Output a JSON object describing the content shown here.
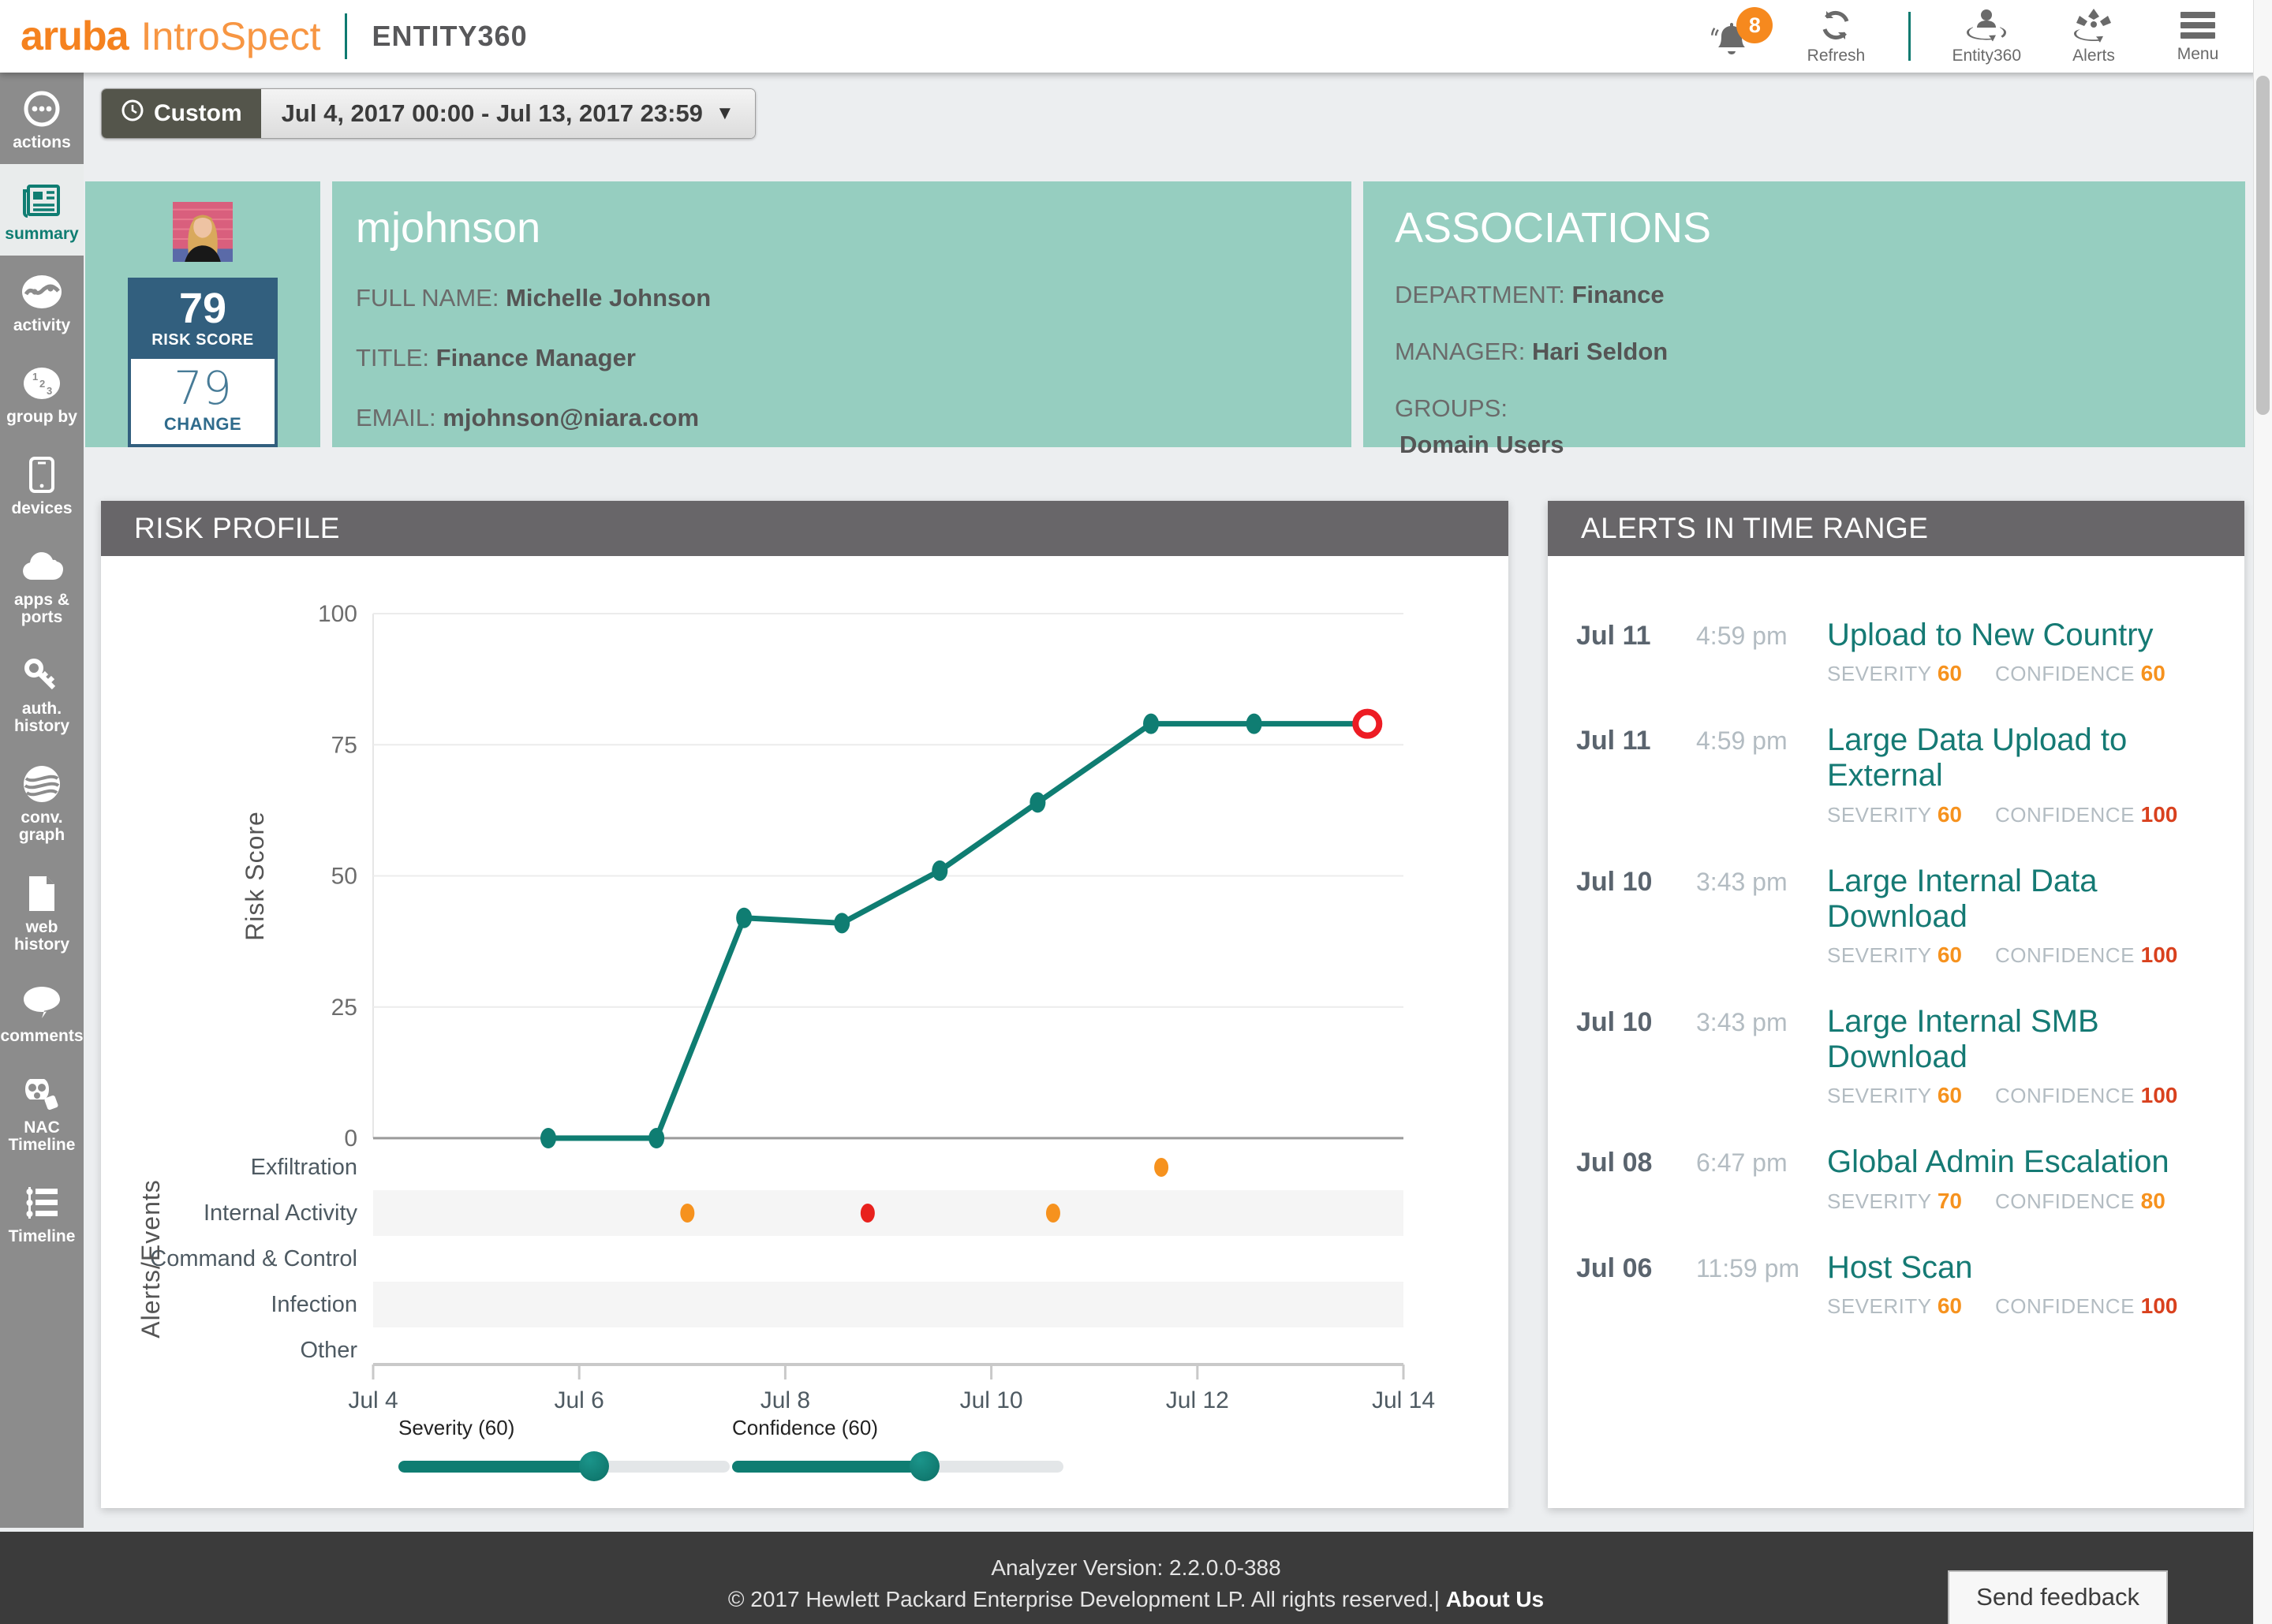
{
  "header": {
    "brand": "aruba",
    "product": "IntroSpect",
    "page_title": "ENTITY360",
    "notification_count": "8",
    "refresh_label": "Refresh",
    "entity360_label": "Entity360",
    "alerts_label": "Alerts",
    "menu_label": "Menu"
  },
  "time_range": {
    "mode_label": "Custom",
    "range_label": "Jul 4, 2017 00:00 - Jul 13, 2017 23:59"
  },
  "sidebar": {
    "items": [
      {
        "label": "actions",
        "active": false
      },
      {
        "label": "summary",
        "active": true
      },
      {
        "label": "activity",
        "active": false
      },
      {
        "label": "group by",
        "active": false
      },
      {
        "label": "devices",
        "active": false
      },
      {
        "label": "apps & ports",
        "active": false
      },
      {
        "label": "auth. history",
        "active": false
      },
      {
        "label": "conv. graph",
        "active": false
      },
      {
        "label": "web history",
        "active": false
      },
      {
        "label": "comments",
        "active": false
      },
      {
        "label": "NAC Timeline",
        "active": false
      },
      {
        "label": "Timeline",
        "active": false
      }
    ]
  },
  "entity": {
    "username": "mjohnson",
    "risk_score": "79",
    "risk_score_label": "RISK SCORE",
    "change": "79",
    "change_label": "CHANGE",
    "full_name_label": "FULL NAME: ",
    "full_name": "Michelle Johnson",
    "title_label": "TITLE: ",
    "title": "Finance Manager",
    "email_label": "EMAIL: ",
    "email": "mjohnson@niara.com"
  },
  "associations": {
    "heading": "ASSOCIATIONS",
    "department_label": "DEPARTMENT: ",
    "department": "Finance",
    "manager_label": "MANAGER: ",
    "manager": "Hari Seldon",
    "groups_label": "GROUPS:",
    "groups": "Domain Users"
  },
  "risk_profile": {
    "heading": "RISK PROFILE",
    "sliders": [
      {
        "label": "Severity (60)",
        "value": 60,
        "percent": 59
      },
      {
        "label": "Confidence (60)",
        "value": 60,
        "percent": 58
      }
    ]
  },
  "chart_data": {
    "type": "line",
    "title": "RISK PROFILE",
    "ylabel": "Risk Score",
    "ylim": [
      0,
      100
    ],
    "yticks": [
      100,
      75,
      50,
      25,
      0
    ],
    "grid": true,
    "line_color": "#0f7d72",
    "x_axis": {
      "tick_days": [
        4,
        6,
        8,
        10,
        12,
        14
      ],
      "tick_labels": [
        "Jul 4",
        "Jul 6",
        "Jul 8",
        "Jul 10",
        "Jul 12",
        "Jul 14"
      ]
    },
    "series": [
      {
        "name": "Risk Score",
        "points": [
          {
            "day": 5.7,
            "score": 0
          },
          {
            "day": 6.75,
            "score": 0
          },
          {
            "day": 7.6,
            "score": 42
          },
          {
            "day": 8.55,
            "score": 41
          },
          {
            "day": 9.5,
            "score": 51
          },
          {
            "day": 10.45,
            "score": 64
          },
          {
            "day": 11.55,
            "score": 79
          },
          {
            "day": 12.55,
            "score": 79
          }
        ]
      }
    ],
    "current_marker": {
      "day": 13.65,
      "score": 79,
      "color": "#ed1c24"
    },
    "events": {
      "ylabel": "Alerts/Events",
      "rows": [
        "Exfiltration",
        "Internal Activity",
        "Command & Control",
        "Infection",
        "Other"
      ],
      "shaded_rows": [
        1,
        3
      ],
      "points": [
        {
          "row": "Exfiltration",
          "day": 11.65,
          "color": "#f6921e"
        },
        {
          "row": "Internal Activity",
          "day": 7.05,
          "color": "#f6921e"
        },
        {
          "row": "Internal Activity",
          "day": 8.8,
          "color": "#e8211d"
        },
        {
          "row": "Internal Activity",
          "day": 10.6,
          "color": "#f6921e"
        }
      ]
    }
  },
  "alerts_panel": {
    "heading": "ALERTS IN TIME RANGE",
    "severity_label": "SEVERITY ",
    "confidence_label": "CONFIDENCE ",
    "alerts": [
      {
        "date": "Jul 11",
        "time": "4:59 pm",
        "title": "Upload to New Country",
        "severity": "60",
        "confidence": "60",
        "severity_color": "#f6921e",
        "confidence_color": "#f6921e"
      },
      {
        "date": "Jul 11",
        "time": "4:59 pm",
        "title": "Large Data Upload to External",
        "severity": "60",
        "confidence": "100",
        "severity_color": "#f6921e",
        "confidence_color": "#d9411e"
      },
      {
        "date": "Jul 10",
        "time": "3:43 pm",
        "title": "Large Internal Data Download",
        "severity": "60",
        "confidence": "100",
        "severity_color": "#f6921e",
        "confidence_color": "#d9411e"
      },
      {
        "date": "Jul 10",
        "time": "3:43 pm",
        "title": "Large Internal SMB Download",
        "severity": "60",
        "confidence": "100",
        "severity_color": "#f6921e",
        "confidence_color": "#d9411e"
      },
      {
        "date": "Jul 08",
        "time": "6:47 pm",
        "title": "Global Admin Escalation",
        "severity": "70",
        "confidence": "80",
        "severity_color": "#f6921e",
        "confidence_color": "#f6921e"
      },
      {
        "date": "Jul 06",
        "time": "11:59 pm",
        "title": "Host Scan",
        "severity": "60",
        "confidence": "100",
        "severity_color": "#f6921e",
        "confidence_color": "#d9411e"
      }
    ]
  },
  "footer": {
    "version": "Analyzer Version: 2.2.0.0-388",
    "copyright": "© 2017 Hewlett Packard Enterprise Development LP. All rights reserved.|",
    "about": "About Us",
    "feedback_button": "Send feedback"
  }
}
